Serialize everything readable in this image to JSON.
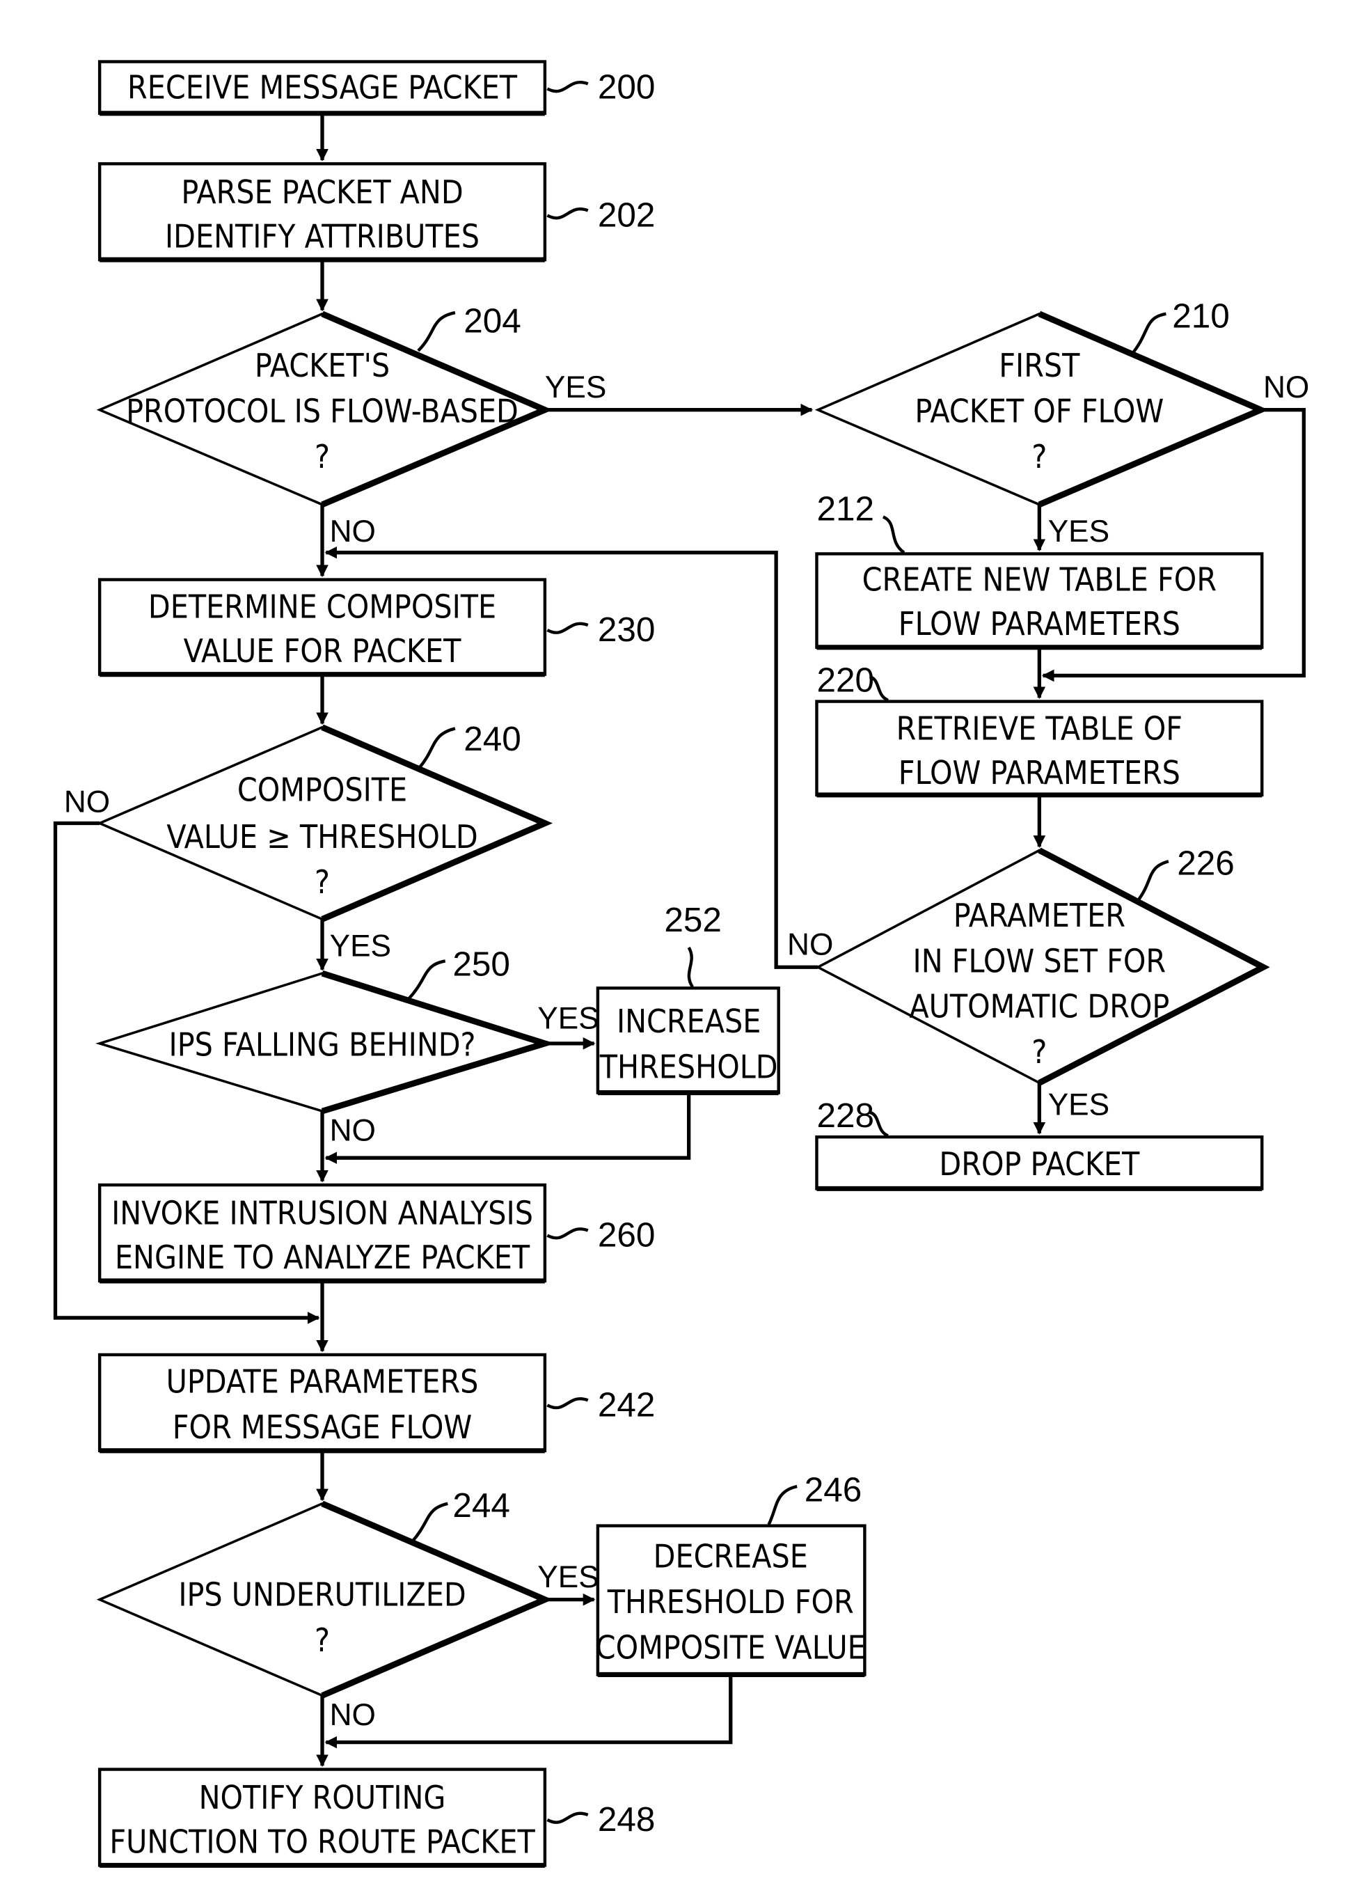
{
  "nodes": {
    "n200": {
      "ref": "200",
      "lines": [
        "RECEIVE MESSAGE PACKET"
      ]
    },
    "n202": {
      "ref": "202",
      "lines": [
        "PARSE PACKET AND",
        "IDENTIFY ATTRIBUTES"
      ]
    },
    "n204": {
      "ref": "204",
      "lines": [
        "PACKET'S",
        "PROTOCOL IS FLOW-BASED",
        "?"
      ]
    },
    "n210": {
      "ref": "210",
      "lines": [
        "FIRST",
        "PACKET OF FLOW",
        "?"
      ]
    },
    "n212": {
      "ref": "212",
      "lines": [
        "CREATE NEW TABLE FOR",
        "FLOW PARAMETERS"
      ]
    },
    "n220": {
      "ref": "220",
      "lines": [
        "RETRIEVE TABLE OF",
        "FLOW PARAMETERS"
      ]
    },
    "n226": {
      "ref": "226",
      "lines": [
        "PARAMETER",
        "IN FLOW SET FOR",
        "AUTOMATIC DROP",
        "?"
      ]
    },
    "n228": {
      "ref": "228",
      "lines": [
        "DROP PACKET"
      ]
    },
    "n230": {
      "ref": "230",
      "lines": [
        "DETERMINE COMPOSITE",
        "VALUE FOR PACKET"
      ]
    },
    "n240": {
      "ref": "240",
      "lines": [
        "COMPOSITE",
        "VALUE ≥ THRESHOLD",
        "?"
      ]
    },
    "n250": {
      "ref": "250",
      "lines": [
        "IPS FALLING BEHIND?"
      ]
    },
    "n252": {
      "ref": "252",
      "lines": [
        "INCREASE",
        "THRESHOLD"
      ]
    },
    "n260": {
      "ref": "260",
      "lines": [
        "INVOKE INTRUSION ANALYSIS",
        "ENGINE TO ANALYZE PACKET"
      ]
    },
    "n242": {
      "ref": "242",
      "lines": [
        "UPDATE PARAMETERS",
        "FOR MESSAGE FLOW"
      ]
    },
    "n244": {
      "ref": "244",
      "lines": [
        "IPS UNDERUTILIZED",
        "?"
      ]
    },
    "n246": {
      "ref": "246",
      "lines": [
        "DECREASE",
        "THRESHOLD FOR",
        "COMPOSITE VALUE"
      ]
    },
    "n248": {
      "ref": "248",
      "lines": [
        "NOTIFY ROUTING",
        "FUNCTION TO ROUTE PACKET"
      ]
    }
  },
  "edge_labels": {
    "yes": "YES",
    "no": "NO"
  }
}
